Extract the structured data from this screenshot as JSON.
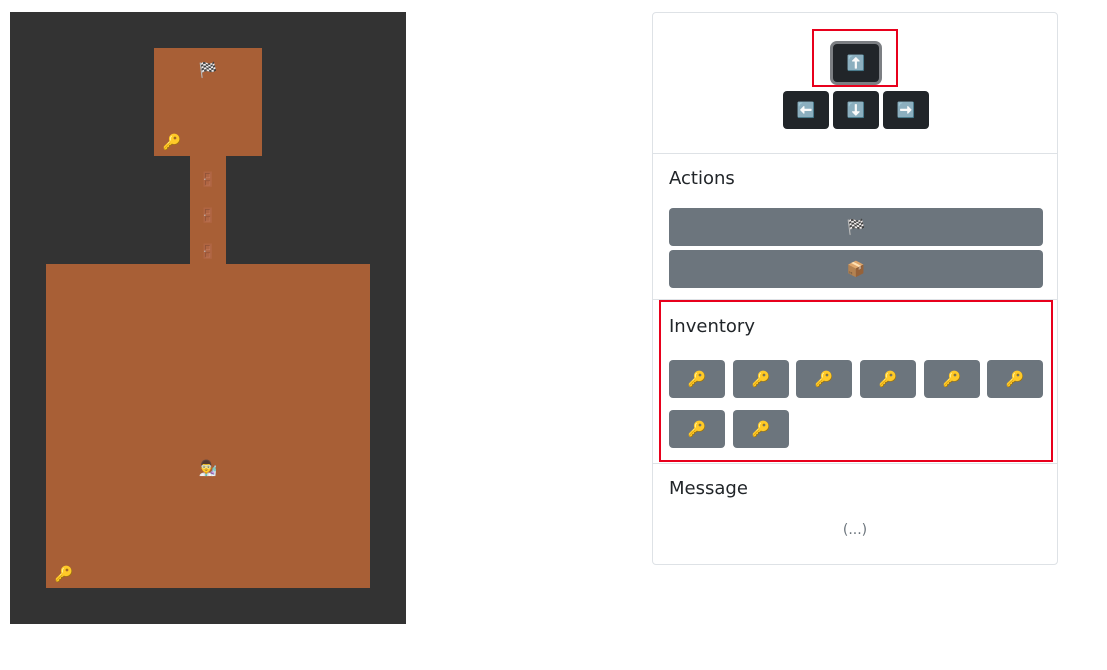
{
  "map": {
    "goal_icon": "🏁",
    "key_icon": "🔑",
    "door_icon": "🚪",
    "player_icon": "👨‍🔬"
  },
  "controls": {
    "up": "⬆️",
    "left": "⬅️",
    "down": "⬇️",
    "right": "➡️"
  },
  "actions": {
    "title": "Actions",
    "items": [
      "🏁",
      "📦"
    ]
  },
  "inventory": {
    "title": "Inventory",
    "items": [
      "🔑",
      "🔑",
      "🔑",
      "🔑",
      "🔑",
      "🔑",
      "🔑",
      "🔑"
    ]
  },
  "message": {
    "title": "Message",
    "text": "(...)"
  },
  "colors": {
    "wall": "#333333",
    "floor": "#a85f36",
    "button_dark": "#212529",
    "button_gray": "#6c757d",
    "highlight": "#e8001c"
  }
}
